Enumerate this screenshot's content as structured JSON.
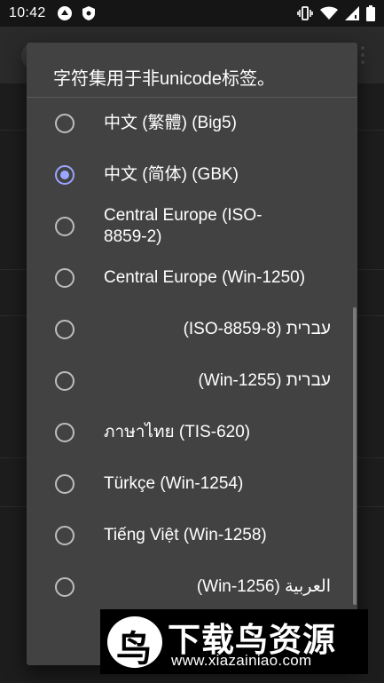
{
  "status_bar": {
    "time": "10:42",
    "left_icons": [
      "app-notification-icon",
      "shield-icon"
    ],
    "right_icons": [
      "vibrate-icon",
      "wifi-icon",
      "signal-icon",
      "battery-icon"
    ]
  },
  "dialog": {
    "title": "字符集用于非unicode标签。",
    "selected_index": 1,
    "options": [
      {
        "label": "中文 (繁體) (Big5)",
        "rtl": false,
        "checked": false
      },
      {
        "label": "中文 (简体) (GBK)",
        "rtl": false,
        "checked": true
      },
      {
        "label": "Central Europe (ISO-8859-2)",
        "rtl": false,
        "checked": false
      },
      {
        "label": "Central Europe (Win-1250)",
        "rtl": false,
        "checked": false
      },
      {
        "label": "עברית (ISO-8859-8)",
        "rtl": true,
        "checked": false
      },
      {
        "label": "עברית (Win-1255)",
        "rtl": true,
        "checked": false
      },
      {
        "label": "ภาษาไทย (TIS-620)",
        "rtl": false,
        "checked": false
      },
      {
        "label": "Türkçe (Win-1254)",
        "rtl": false,
        "checked": false
      },
      {
        "label": "Tiếng Việt (Win-1258)",
        "rtl": false,
        "checked": false
      },
      {
        "label": "العربية (Win-1256)",
        "rtl": true,
        "checked": false
      }
    ]
  },
  "watermark": {
    "title": "下载鸟资源",
    "url": "www.xiazainiao.com",
    "logo_glyph": "鸟"
  },
  "colors": {
    "dialog_bg": "#424242",
    "radio_checked": "#9aa6ff",
    "radio_unchecked": "#bdbdbd"
  }
}
